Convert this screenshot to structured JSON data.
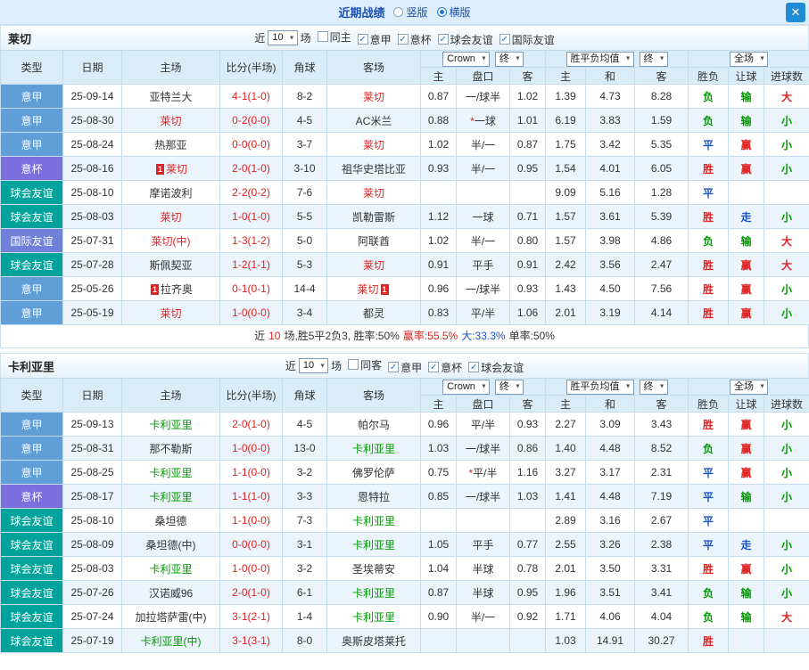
{
  "topbar": {
    "title": "近期战绩",
    "vertical_label": "竖版",
    "horizontal_label": "横版",
    "vertical_selected": false,
    "horizontal_selected": true,
    "close_label": "✕"
  },
  "misc": {
    "badge_text": "1",
    "check_glyph": "✓"
  },
  "colors": {
    "win": "#e02222",
    "lose": "#009900",
    "draw": "#1e56c8",
    "score": "#e02222"
  },
  "league_colors": {
    "意甲": "#5f9ed6",
    "意杯": "#7d6ee0",
    "球会友谊": "#00a39b",
    "国际友谊": "#6f80d8"
  },
  "table_header": {
    "type": "类型",
    "date": "日期",
    "home": "主场",
    "score": "比分(半场)",
    "corner": "角球",
    "away": "客场",
    "crow": "Crown",
    "end": "终",
    "wdl": "胜平负均值",
    "full": "全场",
    "h": "主",
    "pk": "盘口",
    "a": "客",
    "d": "和",
    "wl": "胜负",
    "hcp": "让球",
    "goals": "进球数"
  },
  "sections": [
    {
      "team": "莱切",
      "team_color": "#e02222",
      "filters": {
        "near_label": "近",
        "count": "10",
        "games_label": "场",
        "checkboxes": [
          {
            "label": "同主",
            "checked": false
          },
          {
            "label": "意甲",
            "checked": true
          },
          {
            "label": "意杯",
            "checked": true
          },
          {
            "label": "球会友谊",
            "checked": true
          },
          {
            "label": "国际友谊",
            "checked": true
          }
        ]
      },
      "rows": [
        {
          "lg": "意甲",
          "date": "25-09-14",
          "home": "亚特兰大",
          "hT": false,
          "hB": false,
          "score": "4-1(1-0)",
          "cor": "8-2",
          "away": "莱切",
          "aT": true,
          "aB": false,
          "o1": "0.87",
          "hc": "一/球半",
          "o2": "1.02",
          "e1": "1.39",
          "e2": "4.73",
          "e3": "8.28",
          "res": [
            "负",
            "g"
          ],
          "hres": [
            "输",
            "g"
          ],
          "goal": [
            "大",
            "r"
          ]
        },
        {
          "lg": "意甲",
          "date": "25-08-30",
          "home": "莱切",
          "hT": true,
          "hB": false,
          "score": "0-2(0-0)",
          "cor": "4-5",
          "away": "AC米兰",
          "aT": false,
          "aB": false,
          "o1": "0.88",
          "hc": "*一球",
          "o2": "1.01",
          "e1": "6.19",
          "e2": "3.83",
          "e3": "1.59",
          "res": [
            "负",
            "g"
          ],
          "hres": [
            "输",
            "g"
          ],
          "goal": [
            "小",
            "g"
          ]
        },
        {
          "lg": "意甲",
          "date": "25-08-24",
          "home": "热那亚",
          "hT": false,
          "hB": false,
          "score": "0-0(0-0)",
          "cor": "3-7",
          "away": "莱切",
          "aT": true,
          "aB": false,
          "o1": "1.02",
          "hc": "半/一",
          "o2": "0.87",
          "e1": "1.75",
          "e2": "3.42",
          "e3": "5.35",
          "res": [
            "平",
            "b"
          ],
          "hres": [
            "赢",
            "r"
          ],
          "goal": [
            "小",
            "g"
          ]
        },
        {
          "lg": "意杯",
          "date": "25-08-16",
          "home": "莱切",
          "hT": true,
          "hB": true,
          "score": "2-0(1-0)",
          "cor": "3-10",
          "away": "祖华史塔比亚",
          "aT": false,
          "aB": false,
          "o1": "0.93",
          "hc": "半/一",
          "o2": "0.95",
          "e1": "1.54",
          "e2": "4.01",
          "e3": "6.05",
          "res": [
            "胜",
            "r"
          ],
          "hres": [
            "赢",
            "r"
          ],
          "goal": [
            "小",
            "g"
          ]
        },
        {
          "lg": "球会友谊",
          "date": "25-08-10",
          "home": "摩诺波利",
          "hT": false,
          "hB": false,
          "score": "2-2(0-2)",
          "cor": "7-6",
          "away": "莱切",
          "aT": true,
          "aB": false,
          "o1": "",
          "hc": "",
          "o2": "",
          "e1": "9.09",
          "e2": "5.16",
          "e3": "1.28",
          "res": [
            "平",
            "b"
          ],
          "hres": [
            "",
            ""
          ],
          "goal": [
            "",
            ""
          ]
        },
        {
          "lg": "球会友谊",
          "date": "25-08-03",
          "home": "莱切",
          "hT": true,
          "hB": false,
          "score": "1-0(1-0)",
          "cor": "5-5",
          "away": "凯勒雷斯",
          "aT": false,
          "aB": false,
          "o1": "1.12",
          "hc": "一球",
          "o2": "0.71",
          "e1": "1.57",
          "e2": "3.61",
          "e3": "5.39",
          "res": [
            "胜",
            "r"
          ],
          "hres": [
            "走",
            "b"
          ],
          "goal": [
            "小",
            "g"
          ]
        },
        {
          "lg": "国际友谊",
          "date": "25-07-31",
          "home": "莱切(中)",
          "hT": true,
          "hB": false,
          "score": "1-3(1-2)",
          "cor": "5-0",
          "away": "阿联酋",
          "aT": false,
          "aB": false,
          "o1": "1.02",
          "hc": "半/一",
          "o2": "0.80",
          "e1": "1.57",
          "e2": "3.98",
          "e3": "4.86",
          "res": [
            "负",
            "g"
          ],
          "hres": [
            "输",
            "g"
          ],
          "goal": [
            "大",
            "r"
          ]
        },
        {
          "lg": "球会友谊",
          "date": "25-07-28",
          "home": "斯佩契亚",
          "hT": false,
          "hB": false,
          "score": "1-2(1-1)",
          "cor": "5-3",
          "away": "莱切",
          "aT": true,
          "aB": false,
          "o1": "0.91",
          "hc": "平手",
          "o2": "0.91",
          "e1": "2.42",
          "e2": "3.56",
          "e3": "2.47",
          "res": [
            "胜",
            "r"
          ],
          "hres": [
            "赢",
            "r"
          ],
          "goal": [
            "大",
            "r"
          ]
        },
        {
          "lg": "意甲",
          "date": "25-05-26",
          "home": "拉齐奥",
          "hT": false,
          "hB": true,
          "score": "0-1(0-1)",
          "cor": "14-4",
          "away": "莱切",
          "aT": true,
          "aB": true,
          "o1": "0.96",
          "hc": "一/球半",
          "o2": "0.93",
          "e1": "1.43",
          "e2": "4.50",
          "e3": "7.56",
          "res": [
            "胜",
            "r"
          ],
          "hres": [
            "赢",
            "r"
          ],
          "goal": [
            "小",
            "g"
          ]
        },
        {
          "lg": "意甲",
          "date": "25-05-19",
          "home": "莱切",
          "hT": true,
          "hB": false,
          "score": "1-0(0-0)",
          "cor": "3-4",
          "away": "都灵",
          "aT": false,
          "aB": false,
          "o1": "0.83",
          "hc": "平/半",
          "o2": "1.06",
          "e1": "2.01",
          "e2": "3.19",
          "e3": "4.14",
          "res": [
            "胜",
            "r"
          ],
          "hres": [
            "赢",
            "r"
          ],
          "goal": [
            "小",
            "g"
          ]
        }
      ],
      "summary": [
        {
          "t": "近",
          "c": "#333333"
        },
        {
          "t": "10",
          "c": "#e02222"
        },
        {
          "t": "场,胜5平2负3, 胜率:50%",
          "c": "#333333"
        },
        {
          "t": "赢率:55.5%",
          "c": "#e02222"
        },
        {
          "t": "大:33.3%",
          "c": "#1e56c8"
        },
        {
          "t": "单率:50%",
          "c": "#333333"
        }
      ]
    },
    {
      "team": "卡利亚里",
      "team_color": "#009900",
      "filters": {
        "near_label": "近",
        "count": "10",
        "games_label": "场",
        "checkboxes": [
          {
            "label": "同客",
            "checked": false
          },
          {
            "label": "意甲",
            "checked": true
          },
          {
            "label": "意杯",
            "checked": true
          },
          {
            "label": "球会友谊",
            "checked": true
          }
        ]
      },
      "rows": [
        {
          "lg": "意甲",
          "date": "25-09-13",
          "home": "卡利亚里",
          "hT": true,
          "hB": false,
          "score": "2-0(1-0)",
          "cor": "4-5",
          "away": "帕尔马",
          "aT": false,
          "aB": false,
          "o1": "0.96",
          "hc": "平/半",
          "o2": "0.93",
          "e1": "2.27",
          "e2": "3.09",
          "e3": "3.43",
          "res": [
            "胜",
            "r"
          ],
          "hres": [
            "赢",
            "r"
          ],
          "goal": [
            "小",
            "g"
          ]
        },
        {
          "lg": "意甲",
          "date": "25-08-31",
          "home": "那不勒斯",
          "hT": false,
          "hB": false,
          "score": "1-0(0-0)",
          "cor": "13-0",
          "away": "卡利亚里",
          "aT": true,
          "aB": false,
          "o1": "1.03",
          "hc": "一/球半",
          "o2": "0.86",
          "e1": "1.40",
          "e2": "4.48",
          "e3": "8.52",
          "res": [
            "负",
            "g"
          ],
          "hres": [
            "赢",
            "r"
          ],
          "goal": [
            "小",
            "g"
          ]
        },
        {
          "lg": "意甲",
          "date": "25-08-25",
          "home": "卡利亚里",
          "hT": true,
          "hB": false,
          "score": "1-1(0-0)",
          "cor": "3-2",
          "away": "佛罗伦萨",
          "aT": false,
          "aB": false,
          "o1": "0.75",
          "hc": "*平/半",
          "o2": "1.16",
          "e1": "3.27",
          "e2": "3.17",
          "e3": "2.31",
          "res": [
            "平",
            "b"
          ],
          "hres": [
            "赢",
            "r"
          ],
          "goal": [
            "小",
            "g"
          ]
        },
        {
          "lg": "意杯",
          "date": "25-08-17",
          "home": "卡利亚里",
          "hT": true,
          "hB": false,
          "score": "1-1(1-0)",
          "cor": "3-3",
          "away": "恩特拉",
          "aT": false,
          "aB": false,
          "o1": "0.85",
          "hc": "一/球半",
          "o2": "1.03",
          "e1": "1.41",
          "e2": "4.48",
          "e3": "7.19",
          "res": [
            "平",
            "b"
          ],
          "hres": [
            "输",
            "g"
          ],
          "goal": [
            "小",
            "g"
          ]
        },
        {
          "lg": "球会友谊",
          "date": "25-08-10",
          "home": "桑坦德",
          "hT": false,
          "hB": false,
          "score": "1-1(0-0)",
          "cor": "7-3",
          "away": "卡利亚里",
          "aT": true,
          "aB": false,
          "o1": "",
          "hc": "",
          "o2": "",
          "e1": "2.89",
          "e2": "3.16",
          "e3": "2.67",
          "res": [
            "平",
            "b"
          ],
          "hres": [
            "",
            ""
          ],
          "goal": [
            "",
            ""
          ]
        },
        {
          "lg": "球会友谊",
          "date": "25-08-09",
          "home": "桑坦德(中)",
          "hT": false,
          "hB": false,
          "score": "0-0(0-0)",
          "cor": "3-1",
          "away": "卡利亚里",
          "aT": true,
          "aB": false,
          "o1": "1.05",
          "hc": "平手",
          "o2": "0.77",
          "e1": "2.55",
          "e2": "3.26",
          "e3": "2.38",
          "res": [
            "平",
            "b"
          ],
          "hres": [
            "走",
            "b"
          ],
          "goal": [
            "小",
            "g"
          ]
        },
        {
          "lg": "球会友谊",
          "date": "25-08-03",
          "home": "卡利亚里",
          "hT": true,
          "hB": false,
          "score": "1-0(0-0)",
          "cor": "3-2",
          "away": "圣埃蒂安",
          "aT": false,
          "aB": false,
          "o1": "1.04",
          "hc": "半球",
          "o2": "0.78",
          "e1": "2.01",
          "e2": "3.50",
          "e3": "3.31",
          "res": [
            "胜",
            "r"
          ],
          "hres": [
            "赢",
            "r"
          ],
          "goal": [
            "小",
            "g"
          ]
        },
        {
          "lg": "球会友谊",
          "date": "25-07-26",
          "home": "汉诺威96",
          "hT": false,
          "hB": false,
          "score": "2-0(1-0)",
          "cor": "6-1",
          "away": "卡利亚里",
          "aT": true,
          "aB": false,
          "o1": "0.87",
          "hc": "半球",
          "o2": "0.95",
          "e1": "1.96",
          "e2": "3.51",
          "e3": "3.41",
          "res": [
            "负",
            "g"
          ],
          "hres": [
            "输",
            "g"
          ],
          "goal": [
            "小",
            "g"
          ]
        },
        {
          "lg": "球会友谊",
          "date": "25-07-24",
          "home": "加拉塔萨雷(中)",
          "hT": false,
          "hB": false,
          "score": "3-1(2-1)",
          "cor": "1-4",
          "away": "卡利亚里",
          "aT": true,
          "aB": false,
          "o1": "0.90",
          "hc": "半/一",
          "o2": "0.92",
          "e1": "1.71",
          "e2": "4.06",
          "e3": "4.04",
          "res": [
            "负",
            "g"
          ],
          "hres": [
            "输",
            "g"
          ],
          "goal": [
            "大",
            "r"
          ]
        },
        {
          "lg": "球会友谊",
          "date": "25-07-19",
          "home": "卡利亚里(中)",
          "hT": true,
          "hB": false,
          "score": "3-1(3-1)",
          "cor": "8-0",
          "away": "奥斯皮塔莱托",
          "aT": false,
          "aB": false,
          "o1": "",
          "hc": "",
          "o2": "",
          "e1": "1.03",
          "e2": "14.91",
          "e3": "30.27",
          "res": [
            "胜",
            "r"
          ],
          "hres": [
            "",
            ""
          ],
          "goal": [
            "",
            ""
          ]
        }
      ],
      "summary": null
    }
  ]
}
